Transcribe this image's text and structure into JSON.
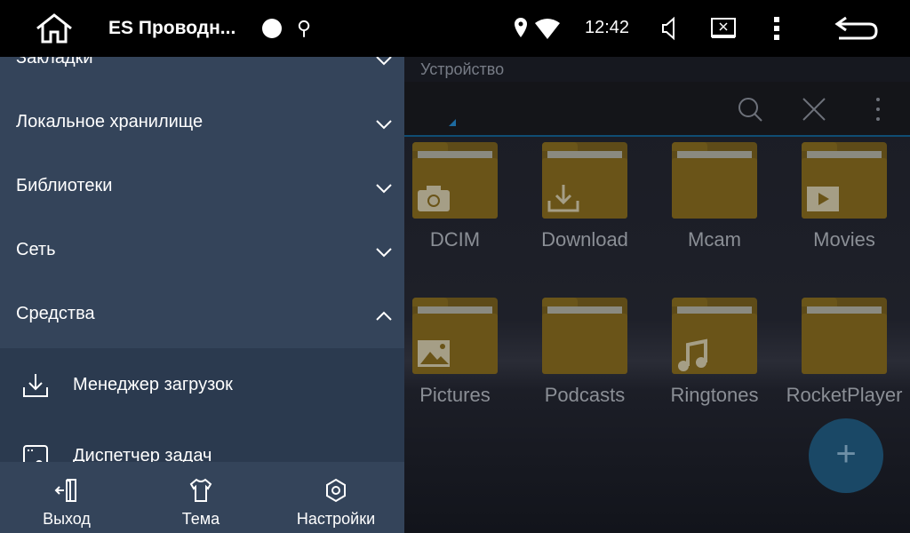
{
  "status_bar": {
    "app_title": "ES Проводн...",
    "time": "12:42",
    "icons": [
      "home-icon",
      "circle-icon",
      "usb-icon",
      "location-icon",
      "wifi-icon",
      "volume-icon",
      "screen-close-icon",
      "more-vert-icon",
      "back-icon"
    ]
  },
  "main": {
    "tab_label": "Устройство",
    "toolbar_icons": [
      "search-icon",
      "close-icon",
      "more-vert-icon"
    ],
    "folders": [
      {
        "name": "DCIM",
        "icon": "camera-icon"
      },
      {
        "name": "Download",
        "icon": "download-icon"
      },
      {
        "name": "Mcam",
        "icon": ""
      },
      {
        "name": "Movies",
        "icon": "play-icon"
      },
      {
        "name": "Pictures",
        "icon": "image-icon"
      },
      {
        "name": "Podcasts",
        "icon": ""
      },
      {
        "name": "Ringtones",
        "icon": "music-icon"
      },
      {
        "name": "RocketPlayer",
        "icon": ""
      }
    ],
    "fab": "add-icon"
  },
  "drawer": {
    "sections": [
      {
        "label": "Закладки",
        "expanded": false
      },
      {
        "label": "Локальное хранилище",
        "expanded": false
      },
      {
        "label": "Библиотеки",
        "expanded": false
      },
      {
        "label": "Сеть",
        "expanded": false
      },
      {
        "label": "Средства",
        "expanded": true
      }
    ],
    "tools": [
      {
        "label": "Менеджер загрузок",
        "icon": "download-icon"
      },
      {
        "label": "Диспетчер задач",
        "icon": "task-manager-icon"
      }
    ],
    "bottom": [
      {
        "label": "Выход",
        "icon": "exit-icon"
      },
      {
        "label": "Тема",
        "icon": "shirt-icon"
      },
      {
        "label": "Настройки",
        "icon": "settings-icon"
      }
    ]
  },
  "colors": {
    "drawer": "#34445a",
    "tools_bg": "#2b3a4f",
    "folder": "#6a5418",
    "accent": "#0f4d73"
  }
}
